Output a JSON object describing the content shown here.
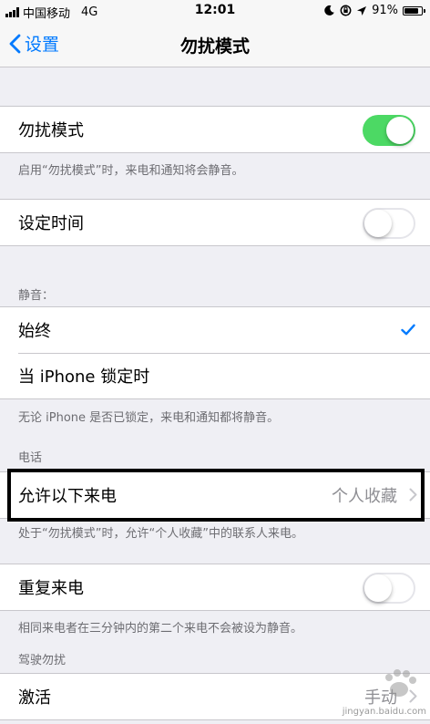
{
  "status_bar": {
    "carrier": "中国移动",
    "network": "4G",
    "time": "12:01",
    "battery": "91%",
    "battery_level": 0.91
  },
  "nav": {
    "back_label": "设置",
    "title": "勿扰模式"
  },
  "dnd": {
    "label": "勿扰模式",
    "enabled": true,
    "footer": "启用“勿扰模式”时，来电和通知将会静音。"
  },
  "scheduled": {
    "label": "设定时间",
    "enabled": false
  },
  "silence": {
    "header": "静音：",
    "options": [
      {
        "label": "始终",
        "selected": true
      },
      {
        "label": "当 iPhone 锁定时",
        "selected": false
      }
    ],
    "footer": "无论 iPhone 是否已锁定，来电和通知都将静音。"
  },
  "phone": {
    "header": "电话",
    "allow_calls_label": "允许以下来电",
    "allow_calls_value": "个人收藏",
    "footer": "处于“勿扰模式”时，允许“个人收藏”中的联系人来电。"
  },
  "repeated_calls": {
    "label": "重复来电",
    "enabled": false,
    "footer": "相同来电者在三分钟内的第二个来电不会被设为静音。"
  },
  "driving": {
    "header": "驾驶勿扰",
    "activate_label": "激活",
    "activate_value": "手动"
  },
  "watermark": {
    "text": "jingyan.baidu.com"
  },
  "colors": {
    "accent": "#007aff",
    "toggle_on": "#4cd964",
    "background": "#efeff4"
  }
}
